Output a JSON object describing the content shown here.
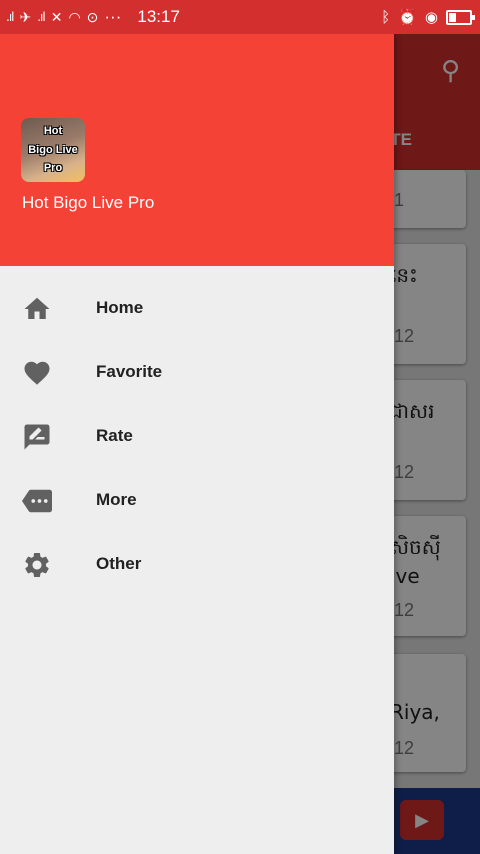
{
  "status_bar": {
    "time": "13:17",
    "signal_1": ".ıl",
    "signal_2": ".ıl",
    "more": "···"
  },
  "drawer": {
    "app_name": "Hot Bigo Live Pro",
    "icon_text": [
      "Hot",
      "Bigo Live",
      "Pro"
    ],
    "items": [
      {
        "label": "Home",
        "icon": "home-icon"
      },
      {
        "label": "Favorite",
        "icon": "heart-icon"
      },
      {
        "label": "Rate",
        "icon": "rate-review-icon"
      },
      {
        "label": "More",
        "icon": "more-icon"
      },
      {
        "label": "Other",
        "icon": "gear-icon"
      }
    ]
  },
  "background": {
    "tab_label": "ORITE",
    "cards": [
      {
        "title": "",
        "date": "1"
      },
      {
        "title": "នេះ",
        "date": "12"
      },
      {
        "title": "ជាសរ",
        "date": "12"
      },
      {
        "title": "សិចស៊ី",
        "subtitle": "ive",
        "date": "12"
      },
      {
        "title": "Riya,",
        "date": "12"
      }
    ]
  },
  "colors": {
    "primary": "#f44336",
    "primary_dark": "#d32f2f",
    "drawer_bg": "#eeeeee",
    "icon": "#616161"
  }
}
